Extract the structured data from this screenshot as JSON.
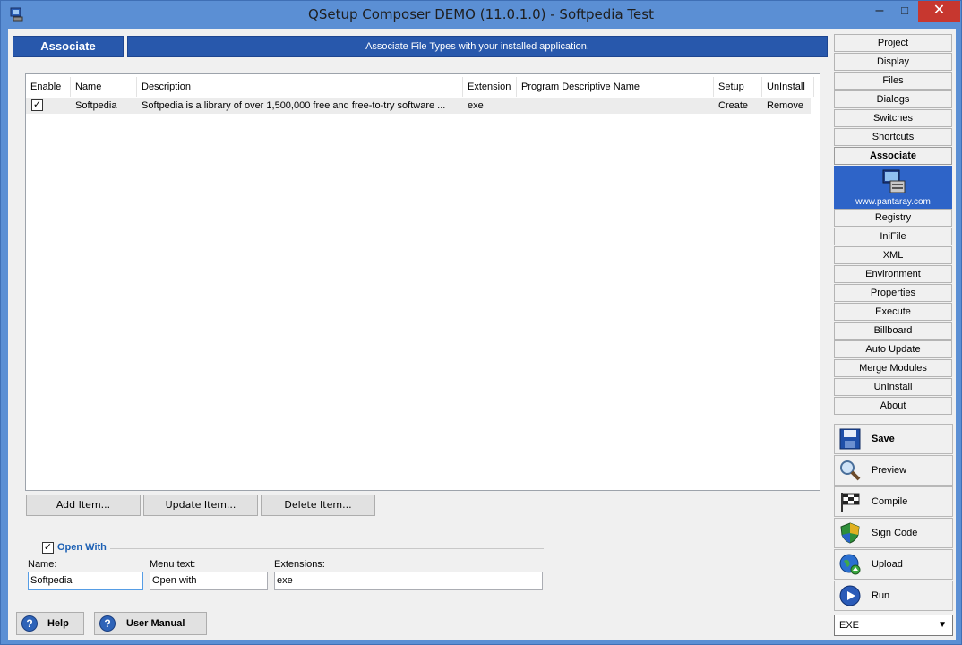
{
  "window": {
    "title": "QSetup Composer DEMO (11.0.1.0) - Softpedia Test",
    "minimize": "–",
    "maximize": "□",
    "close": "✕"
  },
  "header": {
    "section": "Associate",
    "banner": "Associate File Types with your installed application."
  },
  "grid": {
    "columns": [
      "Enable",
      "Name",
      "Description",
      "Extension",
      "Program Descriptive Name",
      "Setup",
      "UnInstall"
    ],
    "rows": [
      {
        "enabled": "✓",
        "name": "Softpedia",
        "description": "Softpedia is a library of over 1,500,000 free and free-to-try software ...",
        "extension": "exe",
        "program_descriptive_name": "",
        "setup": "Create",
        "uninstall": "Remove"
      }
    ]
  },
  "grid_buttons": {
    "add": "Add Item...",
    "update": "Update Item...",
    "delete": "Delete Item..."
  },
  "open_with": {
    "checked": "✓",
    "title": "Open With",
    "name_label": "Name:",
    "name_value": "Softpedia",
    "menu_label": "Menu text:",
    "menu_value": "Open with",
    "ext_label": "Extensions:",
    "ext_value": "exe"
  },
  "footer": {
    "help": "Help",
    "manual": "User Manual"
  },
  "sidebar": {
    "nav_top": [
      "Project",
      "Display",
      "Files",
      "Dialogs",
      "Switches",
      "Shortcuts",
      "Associate"
    ],
    "logo_text": "www.pantaray.com",
    "nav_bottom": [
      "Registry",
      "IniFile",
      "XML",
      "Environment",
      "Properties",
      "Execute",
      "Billboard",
      "Auto Update",
      "Merge Modules",
      "UnInstall",
      "About"
    ],
    "actions": [
      "Save",
      "Preview",
      "Compile",
      "Sign Code",
      "Upload",
      "Run"
    ],
    "output_type": "EXE"
  },
  "colors": {
    "accent": "#2858ac",
    "title_bar": "#5b8fd4",
    "close_button": "#c7372f"
  }
}
